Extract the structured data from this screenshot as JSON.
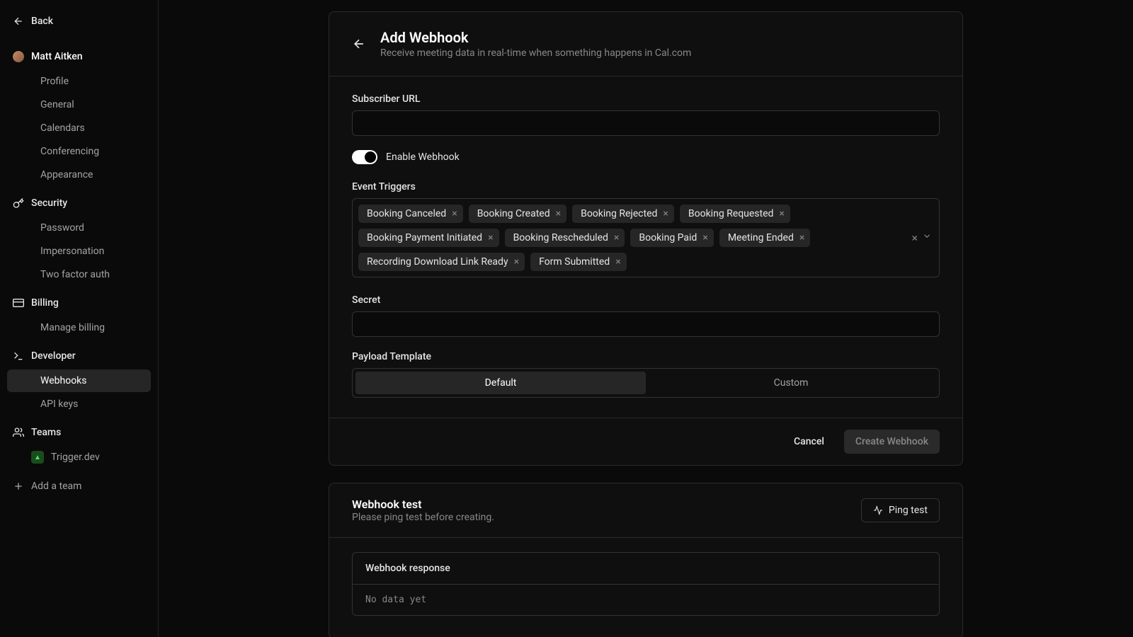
{
  "sidebar": {
    "back_label": "Back",
    "user_name": "Matt Aitken",
    "groups": {
      "profile_items": [
        "Profile",
        "General",
        "Calendars",
        "Conferencing",
        "Appearance"
      ],
      "security_label": "Security",
      "security_items": [
        "Password",
        "Impersonation",
        "Two factor auth"
      ],
      "billing_label": "Billing",
      "billing_items": [
        "Manage billing"
      ],
      "developer_label": "Developer",
      "developer_items": [
        "Webhooks",
        "API keys"
      ],
      "teams_label": "Teams",
      "team_name": "Trigger.dev",
      "add_team_label": "Add a team"
    }
  },
  "header": {
    "title": "Add Webhook",
    "subtitle": "Receive meeting data in real-time when something happens in Cal.com"
  },
  "form": {
    "subscriber_url_label": "Subscriber URL",
    "enable_webhook_label": "Enable Webhook",
    "event_triggers_label": "Event Triggers",
    "triggers": [
      "Booking Canceled",
      "Booking Created",
      "Booking Rejected",
      "Booking Requested",
      "Booking Payment Initiated",
      "Booking Rescheduled",
      "Booking Paid",
      "Meeting Ended",
      "Recording Download Link Ready",
      "Form Submitted"
    ],
    "secret_label": "Secret",
    "payload_template_label": "Payload Template",
    "template_default": "Default",
    "template_custom": "Custom"
  },
  "actions": {
    "cancel": "Cancel",
    "create": "Create Webhook"
  },
  "test": {
    "title": "Webhook test",
    "subtitle": "Please ping test before creating.",
    "ping_label": "Ping test",
    "response_label": "Webhook response",
    "response_body": "No data yet"
  }
}
